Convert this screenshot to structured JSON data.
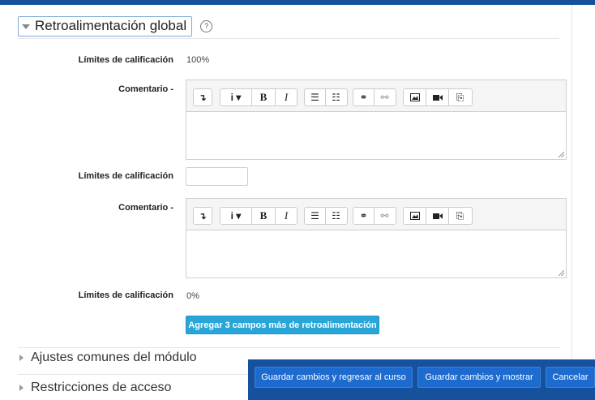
{
  "section": {
    "title": "Retroalimentación global",
    "help_icon": "question-circle-icon"
  },
  "rows": {
    "limit1_label": "Límites de calificación",
    "limit1_value": "100%",
    "comment1_label": "Comentario -",
    "limit2_label": "Límites de calificación",
    "limit2_value": "",
    "comment2_label": "Comentario -",
    "limit3_label": "Límites de calificación",
    "limit3_value": "0%"
  },
  "editor_toolbar": {
    "items": [
      "collapse",
      "paragraph-style",
      "bold",
      "italic",
      "unordered-list",
      "ordered-list",
      "link",
      "unlink",
      "image",
      "video",
      "paste-special"
    ],
    "paragraph_label": "i ▾",
    "bold": "B",
    "italic": "I"
  },
  "add_button": "Agregar 3 campos más de retroalimentación",
  "collapsed_sections": [
    "Ajustes comunes del módulo",
    "Restricciones de acceso"
  ],
  "footer_buttons": {
    "save_return": "Guardar cambios y regresar al curso",
    "save_show": "Guardar cambios y mostrar",
    "cancel": "Cancelar"
  },
  "colors": {
    "brand": "#15519c",
    "button": "#1e6bcf",
    "add_button": "#29a6d8"
  }
}
